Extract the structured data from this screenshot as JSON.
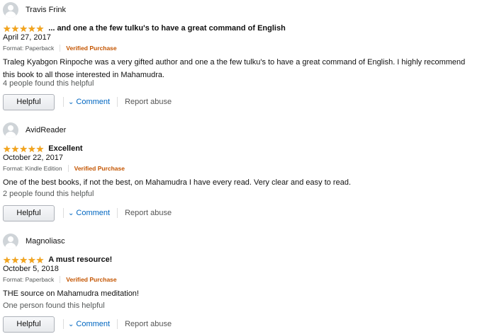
{
  "reviews": [
    {
      "reviewer": "Travis Frink",
      "rating": 5,
      "title": "... and one a the few tulku's to have a great command of English",
      "date": "April 27, 2017",
      "format": "Format: Paperback",
      "verified": "Verified Purchase",
      "body": "Traleg Kyabgon Rinpoche was a very gifted author and one a the few tulku's to have a great command of English. I highly recommend this book to all those interested in Mahamudra.",
      "helpful_count": "4 people found this helpful",
      "helpful_label": "Helpful",
      "comment_label": "Comment",
      "report_label": "Report abuse"
    },
    {
      "reviewer": "AvidReader",
      "rating": 5,
      "title": "Excellent",
      "date": "October 22, 2017",
      "format": "Format: Kindle Edition",
      "verified": "Verified Purchase",
      "body": "One of the best books, if not the best, on Mahamudra I have every read. Very clear and easy to read.",
      "helpful_count": "2 people found this helpful",
      "helpful_label": "Helpful",
      "comment_label": "Comment",
      "report_label": "Report abuse"
    },
    {
      "reviewer": "Magnoliasc",
      "rating": 5,
      "title": "A must resource!",
      "date": "October 5, 2018",
      "format": "Format: Paperback",
      "verified": "Verified Purchase",
      "body": "THE source on Mahamudra meditation!",
      "helpful_count": "One person found this helpful",
      "helpful_label": "Helpful",
      "comment_label": "Comment",
      "report_label": "Report abuse"
    }
  ],
  "colors": {
    "star": "#f4a41c",
    "verified": "#c45500",
    "link": "#0066c0",
    "muted": "#565959"
  },
  "icons": {
    "avatar": "user-avatar-icon",
    "star": "star-icon",
    "chevron": "chevron-down-icon"
  }
}
